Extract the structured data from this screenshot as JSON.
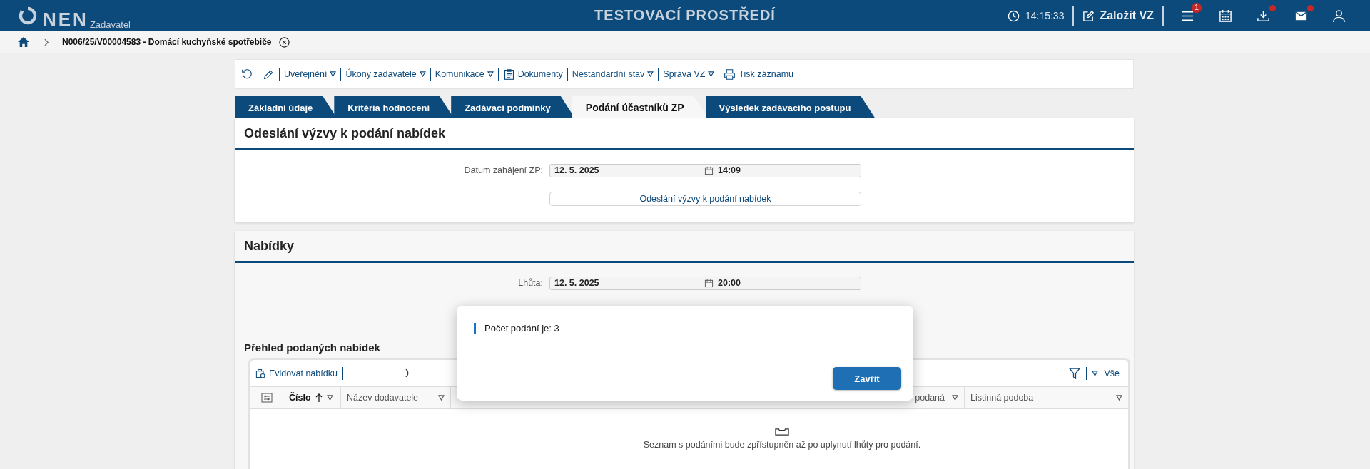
{
  "header": {
    "logo_text": "NEN",
    "logo_subtitle": "Zadavatel",
    "environment": "TESTOVACÍ PROSTŘEDÍ",
    "clock": "14:15:33",
    "create_button": "Založit VZ",
    "icons": [
      {
        "kind": "menu",
        "badge": "1"
      },
      {
        "kind": "calendar"
      },
      {
        "kind": "download",
        "notification": true
      },
      {
        "kind": "mail",
        "notification": true
      },
      {
        "kind": "user"
      }
    ]
  },
  "breadcrumb": {
    "title": "N006/25/V00004583 - Domácí kuchyňské spotřebiče"
  },
  "toolbar": [
    {
      "kind": "refresh"
    },
    {
      "kind": "edit"
    },
    {
      "kind": "menu",
      "label": "Uveřejnění"
    },
    {
      "kind": "menu",
      "label": "Úkony zadavatele"
    },
    {
      "kind": "menu",
      "label": "Komunikace"
    },
    {
      "kind": "documents",
      "label": "Dokumenty"
    },
    {
      "kind": "menu",
      "label": "Nestandardní stav"
    },
    {
      "kind": "menu",
      "label": "Správa VZ"
    },
    {
      "kind": "print",
      "label": "Tisk záznamu"
    }
  ],
  "tabs": [
    {
      "label": "Základní údaje",
      "selected": false
    },
    {
      "label": "Kritéria hodnocení",
      "selected": false
    },
    {
      "label": "Zadávací podmínky",
      "selected": false
    },
    {
      "label": "Podání účastníků ZP",
      "selected": true
    },
    {
      "label": "Výsledek zadávacího postupu",
      "selected": false
    }
  ],
  "invitation": {
    "title": "Odeslání výzvy k podání nabídek",
    "field": {
      "label": "Datum zahájení ZP:",
      "date": "12. 5. 2025",
      "time": "14:09"
    },
    "button": "Odeslání výzvy k podání nabídek"
  },
  "offers": {
    "title": "Nabídky",
    "field": {
      "label": "Lhůta:",
      "date": "12. 5. 2025",
      "time": "20:00"
    }
  },
  "offers_table": {
    "title": "Přehled podaných nabídek",
    "action": "Evidovat nabídku",
    "view": "Vše",
    "columns": [
      {
        "label": "Číslo",
        "sorted": true
      },
      {
        "label": "Název dodavatele",
        "sorted": false
      },
      {
        "label": "podaná",
        "sorted": false
      },
      {
        "label": "Listinná podoba",
        "sorted": false
      }
    ],
    "empty_message": "Seznam s podáními bude zpřístupněn až po uplynutí lhůty pro podání."
  },
  "dialog": {
    "message": "Počet podání je: 3",
    "button": "Zavřít"
  }
}
